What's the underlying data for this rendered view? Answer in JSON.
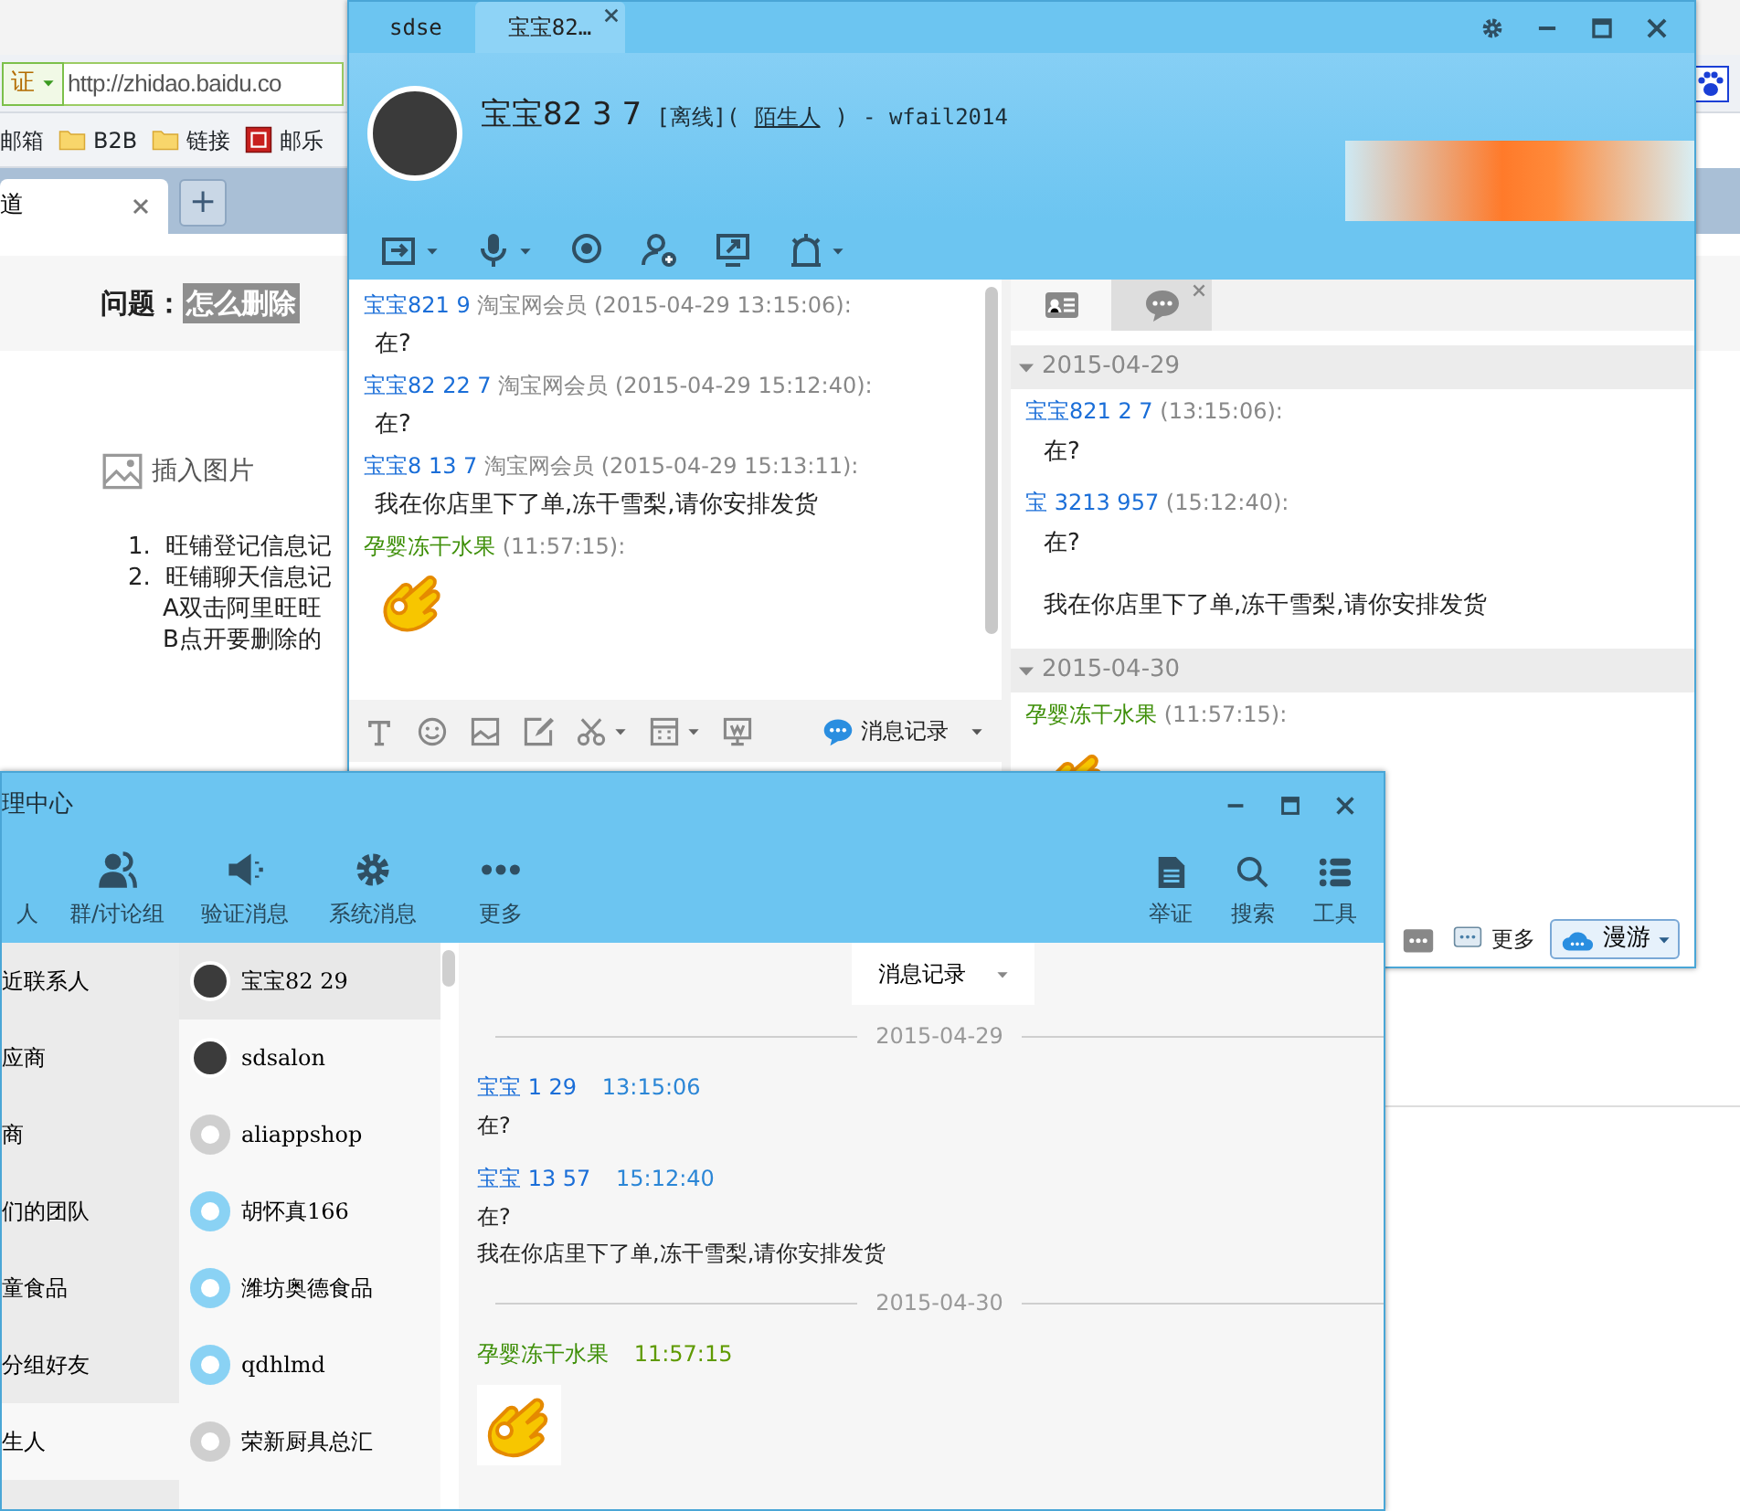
{
  "browser": {
    "cert_badge": "证",
    "url": "http://zhidao.baidu.co",
    "bookmarks": [
      {
        "label": "邮箱",
        "kind": "plain"
      },
      {
        "label": "B2B",
        "kind": "folder"
      },
      {
        "label": "链接",
        "kind": "folder"
      },
      {
        "label": "邮乐",
        "kind": "site"
      }
    ],
    "tabs": [
      {
        "label": "道",
        "selected": true
      }
    ],
    "new_tab": "+",
    "question_label": "问题：",
    "question_title": "怎么删除",
    "insert_image": "插入图片",
    "steps": [
      {
        "number": "1.",
        "text": "旺铺登记信息记"
      },
      {
        "number": "2.",
        "text": "旺铺聊天信息记"
      }
    ],
    "substeps": [
      "A双击阿里旺旺",
      "B点开要删除的"
    ]
  },
  "chat_window": {
    "tabs": [
      {
        "label": "sdse",
        "selected": false,
        "closable": false
      },
      {
        "label": "宝宝82…",
        "selected": true,
        "closable": true
      }
    ],
    "contact": {
      "name": "宝宝82  3  7",
      "status": "[离线](",
      "relation": "陌生人",
      "relation_end": ")",
      "account": "- wfail2014"
    },
    "toolbar": [
      {
        "kind": "file",
        "dropdown": true
      },
      {
        "kind": "voice",
        "dropdown": true
      },
      {
        "kind": "video",
        "dropdown": false
      },
      {
        "kind": "add-contact",
        "dropdown": false
      },
      {
        "kind": "screen",
        "dropdown": false
      },
      {
        "kind": "alert",
        "dropdown": true
      }
    ],
    "messages": [
      {
        "sender": "宝宝821  9",
        "member": "淘宝网会员",
        "time": "(2015-04-29 13:15:06):",
        "kind": "buyer",
        "lines": [
          "在?"
        ],
        "sticker": false
      },
      {
        "sender": "宝宝82  22  7",
        "member": "淘宝网会员",
        "time": "(2015-04-29 15:12:40):",
        "kind": "buyer",
        "lines": [
          "在?"
        ],
        "sticker": false
      },
      {
        "sender": "宝宝8 13  7",
        "member": "淘宝网会员",
        "time": "(2015-04-29 15:13:11):",
        "kind": "buyer",
        "lines": [
          "我在你店里下了单,冻干雪梨,请你安排发货"
        ],
        "sticker": false
      },
      {
        "sender": "孕婴冻干水果",
        "time": "(11:57:15):",
        "kind": "seller",
        "sticker": true
      }
    ],
    "input_toolbar": [
      {
        "kind": "font",
        "dropdown": false
      },
      {
        "kind": "emoji",
        "dropdown": false
      },
      {
        "kind": "image",
        "dropdown": false
      },
      {
        "kind": "edit",
        "dropdown": false
      },
      {
        "kind": "cut",
        "dropdown": true
      },
      {
        "kind": "calculator",
        "dropdown": true
      },
      {
        "kind": "remote",
        "dropdown": false
      }
    ],
    "history_button": "消息记录",
    "side_tabs": [
      {
        "kind": "card",
        "selected": false,
        "closable": false
      },
      {
        "kind": "chat",
        "selected": true,
        "closable": true
      }
    ],
    "history": [
      {
        "date": "2015-04-29",
        "expanded": true,
        "messages": [
          {
            "sender": "宝宝821  2  7",
            "time": "(13:15:06):",
            "kind": "buyer",
            "lines": [
              "在?"
            ],
            "sticker": false
          },
          {
            "sender": "宝  3213  957",
            "time": "(15:12:40):",
            "kind": "buyer",
            "lines": [
              "在?",
              "我在你店里下了单,冻干雪梨,请你安排发货"
            ],
            "sticker": false
          }
        ]
      },
      {
        "date": "2015-04-30",
        "expanded": true,
        "messages": [
          {
            "sender": "孕婴冻干水果",
            "time": "(11:57:15):",
            "kind": "seller",
            "sticker": true
          }
        ]
      }
    ],
    "more": "更多",
    "roam": "漫游"
  },
  "manager_window": {
    "title": "理中心",
    "nav": [
      {
        "label": "人"
      },
      {
        "label": "群/讨论组",
        "kind": "group"
      },
      {
        "label": "验证消息",
        "kind": "speaker"
      },
      {
        "label": "系统消息",
        "kind": "gear"
      },
      {
        "label": "更多",
        "kind": "dots"
      }
    ],
    "tools": [
      {
        "label": "举证",
        "kind": "document"
      },
      {
        "label": "搜索",
        "kind": "search"
      },
      {
        "label": "工具",
        "kind": "list"
      }
    ],
    "groups": [
      {
        "label": "近联系人",
        "selected": false
      },
      {
        "label": "应商",
        "selected": false
      },
      {
        "label": "商",
        "selected": false
      },
      {
        "label": "们的团队",
        "selected": false
      },
      {
        "label": "童食品",
        "selected": false
      },
      {
        "label": "分组好友",
        "selected": false
      },
      {
        "label": "生人",
        "selected": true
      }
    ],
    "contacts": [
      {
        "name": "宝宝82  29",
        "kind": "photo",
        "selected": true
      },
      {
        "name": "sdsalon",
        "kind": "photo",
        "selected": false
      },
      {
        "name": "aliappshop",
        "kind": "offline",
        "selected": false
      },
      {
        "name": "胡怀真166",
        "kind": "online",
        "selected": false
      },
      {
        "name": "潍坊奥德食品",
        "kind": "online",
        "selected": false
      },
      {
        "name": "qdhlmd",
        "kind": "online",
        "selected": false
      },
      {
        "name": "荣新厨具总汇",
        "kind": "offline",
        "selected": false
      }
    ],
    "history_dropdown": "消息记录",
    "history": [
      {
        "date": "2015-04-29",
        "messages": [
          {
            "sender": "宝宝  1  29",
            "time": "13:15:06",
            "kind": "buyer",
            "lines": [
              "在?"
            ],
            "sticker": false
          },
          {
            "sender": "宝宝  13  57",
            "time": "15:12:40",
            "kind": "buyer",
            "lines": [
              "在?",
              "我在你店里下了单,冻干雪梨,请你安排发货"
            ],
            "sticker": false
          }
        ]
      },
      {
        "date": "2015-04-30",
        "messages": [
          {
            "sender": "孕婴冻干水果",
            "time": "11:57:15",
            "kind": "seller",
            "sticker": true
          }
        ]
      }
    ]
  }
}
